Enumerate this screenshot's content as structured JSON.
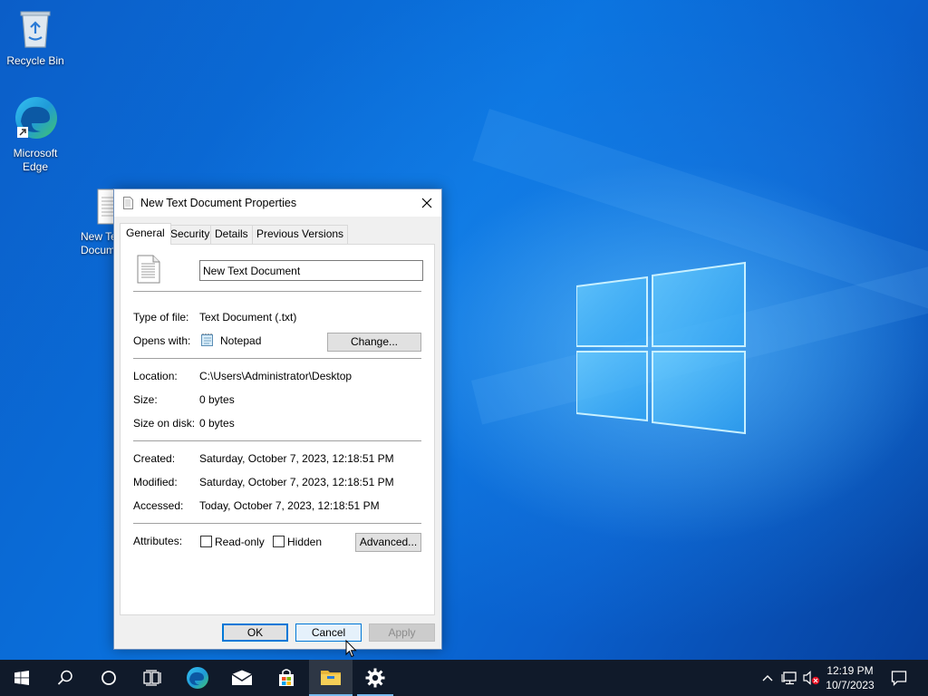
{
  "desktop": {
    "icons": [
      {
        "label": "Recycle Bin"
      },
      {
        "label": "Microsoft\nEdge"
      },
      {
        "label": "New Text Document"
      }
    ]
  },
  "dialog": {
    "title": "New Text Document Properties",
    "tabs": [
      "General",
      "Security",
      "Details",
      "Previous Versions"
    ],
    "active_tab": "General",
    "file_name": "New Text Document",
    "type_of_file_label": "Type of file:",
    "type_of_file_value": "Text Document (.txt)",
    "opens_with_label": "Opens with:",
    "opens_with_value": "Notepad",
    "change_button": "Change...",
    "location_label": "Location:",
    "location_value": "C:\\Users\\Administrator\\Desktop",
    "size_label": "Size:",
    "size_value": "0 bytes",
    "size_on_disk_label": "Size on disk:",
    "size_on_disk_value": "0 bytes",
    "created_label": "Created:",
    "created_value": "Saturday, October 7, 2023, 12:18:51 PM",
    "modified_label": "Modified:",
    "modified_value": "Saturday, October 7, 2023, 12:18:51 PM",
    "accessed_label": "Accessed:",
    "accessed_value": "Today, October 7, 2023, 12:18:51 PM",
    "attributes_label": "Attributes:",
    "readonly_label": "Read-only",
    "readonly_checked": false,
    "hidden_label": "Hidden",
    "hidden_checked": false,
    "advanced_button": "Advanced...",
    "ok_button": "OK",
    "cancel_button": "Cancel",
    "apply_button": "Apply"
  },
  "taskbar": {
    "clock_time": "12:19 PM",
    "clock_date": "10/7/2023",
    "items": [
      "start",
      "search",
      "task-view",
      "cortana",
      "edge",
      "mail",
      "store",
      "file-explorer",
      "settings"
    ]
  },
  "colors": {
    "accent": "#0078d7",
    "taskbar": "#101a2a",
    "wallpaper": "#0a73df"
  }
}
